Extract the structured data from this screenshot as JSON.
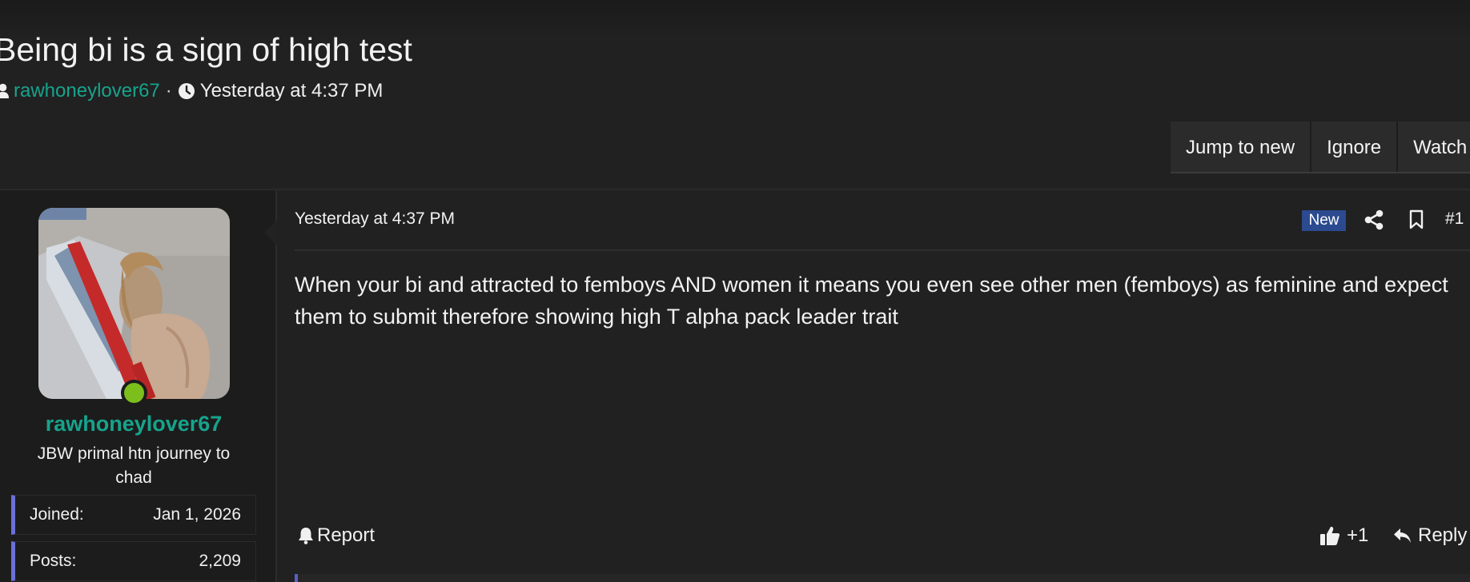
{
  "thread": {
    "title": "Being bi is a sign of high test",
    "author": "rawhoneylover67",
    "separator": "·",
    "time": "Yesterday at 4:37 PM"
  },
  "thread_actions": {
    "jump_to_new": "Jump to new",
    "ignore": "Ignore",
    "watch": "Watch"
  },
  "user": {
    "username": "rawhoneylover67",
    "title": "JBW primal htn journey to chad",
    "stats": [
      {
        "label": "Joined:",
        "value": "Jan 1, 2026"
      },
      {
        "label": "Posts:",
        "value": "2,209"
      }
    ],
    "online": true
  },
  "post": {
    "date": "Yesterday at 4:37 PM",
    "badge": "New",
    "number": "#1",
    "body": "When your bi and attracted to femboys AND women it means you even see other men (femboys) as feminine and expect them to submit therefore showing high T alpha pack leader trait",
    "report": "Report",
    "like": "+1",
    "reply": "Reply"
  },
  "colors": {
    "background": "#212121",
    "accent_teal": "#17a38c",
    "new_badge": "#2c4a8f",
    "online": "#7cbf1c",
    "stat_border": "#6b6fd8"
  },
  "icons": {
    "author": "user-icon",
    "time": "clock-icon",
    "share": "share-icon",
    "bookmark": "bookmark-icon",
    "report": "bell-icon",
    "like": "thumbs-up-icon",
    "reply": "reply-icon"
  }
}
